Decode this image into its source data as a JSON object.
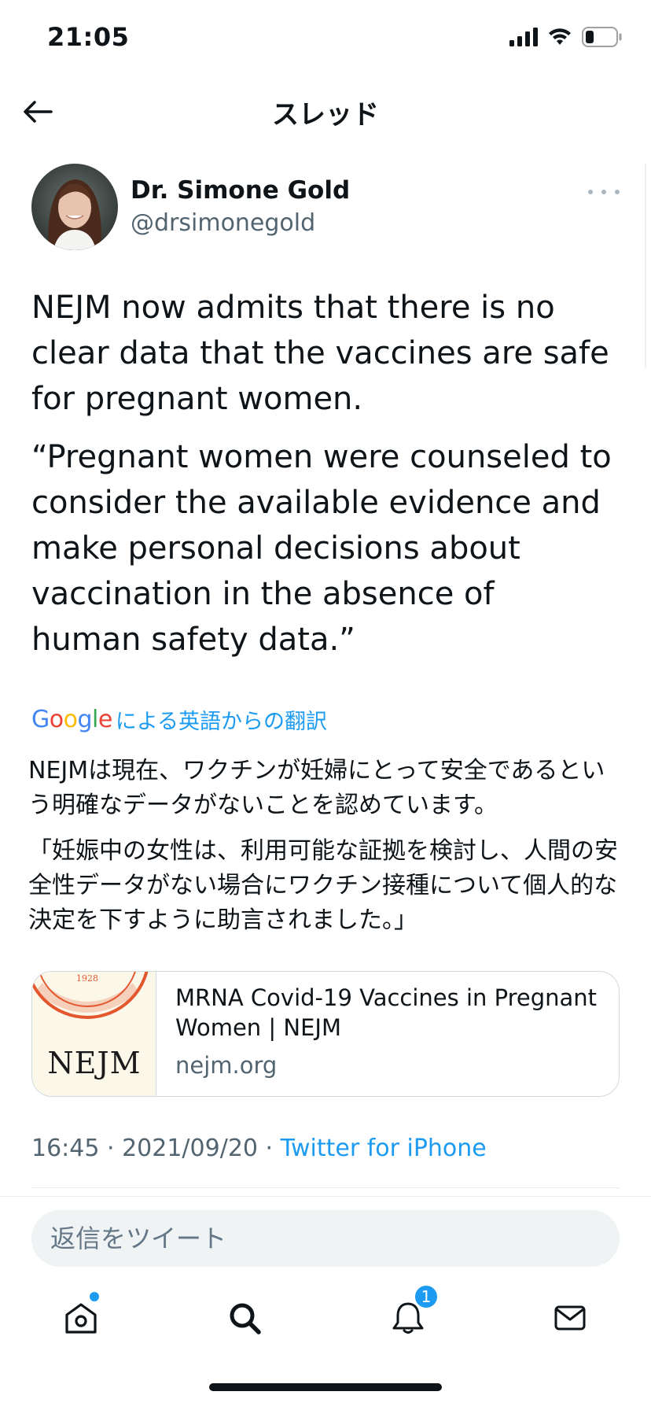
{
  "status_bar": {
    "time": "21:05"
  },
  "nav": {
    "title": "スレッド"
  },
  "author": {
    "name": "Dr. Simone Gold",
    "handle": "@drsimonegold"
  },
  "tweet": {
    "paragraph_1": "NEJM now admits that there is no clear data that the vaccines are safe for pregnant women.",
    "paragraph_2": "“Pregnant women were counseled to consider the available evidence and make personal decisions about vaccination in the absence of human safety data.”"
  },
  "translation": {
    "provider_logo": "Google",
    "label": "による英語からの翻訳",
    "paragraph_1": "NEJMは現在、ワクチンが妊婦にとって安全であるという明確なデータがないことを認めています。",
    "paragraph_2": "「妊娠中の女性は、利用可能な証拠を検討し、人間の安全性データがない場合にワクチン接種について個人的な決定を下すように助言されました。」"
  },
  "link_card": {
    "thumbnail_text": "NEJM",
    "seal_year": "1928",
    "title": "MRNA Covid-19 Vaccines in Pregnant Women | NEJM",
    "domain": "nejm.org"
  },
  "timestamp": {
    "time": "16:45",
    "separator": " · ",
    "date": "2021/09/20",
    "source": "Twitter for iPhone"
  },
  "reply": {
    "placeholder": "返信をツイート"
  },
  "tabs": {
    "notifications_badge": "1",
    "items": [
      "home-icon",
      "search-icon",
      "notifications-icon",
      "messages-icon"
    ]
  },
  "colors": {
    "accent": "#1d9bf0",
    "text": "#0f1419",
    "secondary": "#536471",
    "seal": "#e4572e"
  }
}
